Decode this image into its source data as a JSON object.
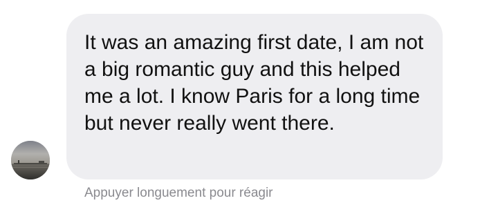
{
  "message": {
    "text": "It was an amazing first date, I am not a big romantic guy and this helped me a lot. I know Paris for a long time but never really went there.",
    "hint": "Appuyer longuement pour réagir"
  },
  "avatar": {
    "icon": "profile-photo-lake"
  },
  "colors": {
    "bubble_background": "#eeeef1",
    "text": "#111111",
    "hint": "#8a8a8f"
  }
}
